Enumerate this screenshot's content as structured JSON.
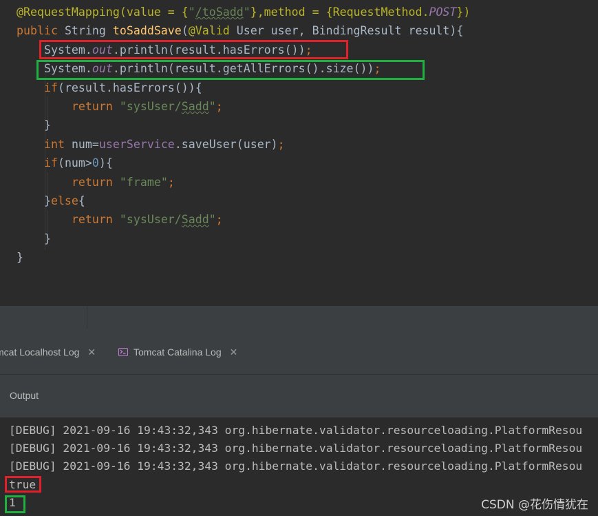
{
  "code": {
    "lines": [
      [
        {
          "t": "@RequestMapping(value = {",
          "c": "annotation"
        },
        {
          "t": "\"",
          "c": "str"
        },
        {
          "t": "/toSadd",
          "c": "str",
          "sq": true
        },
        {
          "t": "\"",
          "c": "str"
        },
        {
          "t": "},method = {RequestMethod.",
          "c": "annotation"
        },
        {
          "t": "POST",
          "c": "field"
        },
        {
          "t": "})",
          "c": "annotation"
        }
      ],
      [
        {
          "t": "public ",
          "c": "kw"
        },
        {
          "t": "String ",
          "c": "plain"
        },
        {
          "t": "toSaddSave",
          "c": "fn"
        },
        {
          "t": "(",
          "c": "plain"
        },
        {
          "t": "@Valid ",
          "c": "annotation"
        },
        {
          "t": "User user, BindingResult result){",
          "c": "plain"
        }
      ],
      [
        {
          "t": "    System.",
          "c": "plain"
        },
        {
          "t": "out",
          "c": "field"
        },
        {
          "t": ".println(result.hasErrors())",
          "c": "plain"
        },
        {
          "t": ";",
          "c": "kw"
        }
      ],
      [
        {
          "t": "    System.",
          "c": "plain"
        },
        {
          "t": "out",
          "c": "field"
        },
        {
          "t": ".println(result.getAllErrors().size())",
          "c": "plain"
        },
        {
          "t": ";",
          "c": "kw"
        }
      ],
      [
        {
          "t": "    ",
          "c": "plain"
        },
        {
          "t": "if",
          "c": "kw"
        },
        {
          "t": "(result.hasErrors()){",
          "c": "plain"
        }
      ],
      [
        {
          "t": "        ",
          "c": "plain"
        },
        {
          "t": "return ",
          "c": "kw"
        },
        {
          "t": "\"sysUser/",
          "c": "str"
        },
        {
          "t": "Sadd",
          "c": "str",
          "sq": true
        },
        {
          "t": "\"",
          "c": "str"
        },
        {
          "t": ";",
          "c": "kw"
        }
      ],
      [
        {
          "t": "    }",
          "c": "plain"
        }
      ],
      [
        {
          "t": "    ",
          "c": "plain"
        },
        {
          "t": "int ",
          "c": "kw"
        },
        {
          "t": "num=",
          "c": "plain"
        },
        {
          "t": "userService",
          "c": "inst"
        },
        {
          "t": ".saveUser(user)",
          "c": "plain"
        },
        {
          "t": ";",
          "c": "kw"
        }
      ],
      [
        {
          "t": "    ",
          "c": "plain"
        },
        {
          "t": "if",
          "c": "kw"
        },
        {
          "t": "(num>",
          "c": "plain"
        },
        {
          "t": "0",
          "c": "num"
        },
        {
          "t": "){",
          "c": "plain"
        }
      ],
      [
        {
          "t": "        ",
          "c": "plain"
        },
        {
          "t": "return ",
          "c": "kw"
        },
        {
          "t": "\"frame\"",
          "c": "str"
        },
        {
          "t": ";",
          "c": "kw"
        }
      ],
      [
        {
          "t": "    }",
          "c": "plain"
        },
        {
          "t": "else",
          "c": "kw"
        },
        {
          "t": "{",
          "c": "plain"
        }
      ],
      [
        {
          "t": "        ",
          "c": "plain"
        },
        {
          "t": "return ",
          "c": "kw"
        },
        {
          "t": "\"sysUser/",
          "c": "str"
        },
        {
          "t": "Sadd",
          "c": "str",
          "sq": true
        },
        {
          "t": "\"",
          "c": "str"
        },
        {
          "t": ";",
          "c": "kw"
        }
      ],
      [
        {
          "t": "    }",
          "c": "plain"
        }
      ],
      [
        {
          "t": "}",
          "c": "plain"
        }
      ]
    ]
  },
  "tabs": [
    {
      "label": "mcat Localhost Log",
      "icon": "close-icon"
    },
    {
      "label": "Tomcat Catalina Log",
      "icon": "terminal-icon"
    }
  ],
  "tab_close_glyph": "✕",
  "output": {
    "label": "Output"
  },
  "console": {
    "lines": [
      "[DEBUG] 2021-09-16 19:43:32,343 org.hibernate.validator.resourceloading.PlatformResou",
      "[DEBUG] 2021-09-16 19:43:32,343 org.hibernate.validator.resourceloading.PlatformResou",
      "[DEBUG] 2021-09-16 19:43:32,343 org.hibernate.validator.resourceloading.PlatformResou",
      "true",
      "1"
    ]
  },
  "watermark": "CSDN @花伤情犹在",
  "colors": {
    "highlight_red": "#e0202a",
    "highlight_green": "#1fb041"
  }
}
